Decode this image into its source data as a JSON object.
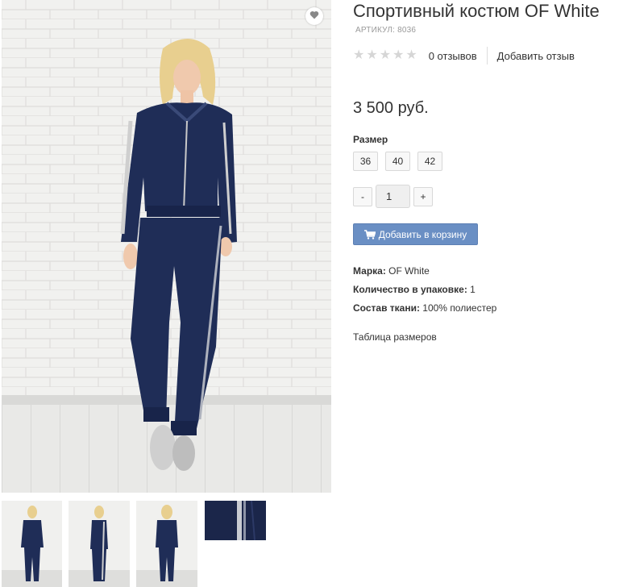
{
  "product": {
    "title": "Спортивный костюм OF White",
    "sku_label": "АРТИКУЛ:",
    "sku": "8036",
    "rating": {
      "stars_filled": 0,
      "stars_total": 5,
      "reviews": "0 отзывов",
      "add_review": "Добавить отзыв"
    },
    "price": "3 500 руб.",
    "size_label": "Размер",
    "sizes": [
      "36",
      "40",
      "42"
    ],
    "quantity": {
      "minus": "-",
      "value": "1",
      "plus": "+"
    },
    "add_to_cart": "Добавить в корзину",
    "specs": [
      {
        "label": "Марка:",
        "value": " OF White"
      },
      {
        "label": "Количество в упаковке:",
        "value": " 1"
      },
      {
        "label": "Состав ткани:",
        "value": " 100% полиестер"
      }
    ],
    "size_table_link": "Таблица размеров"
  },
  "icons": {
    "wishlist": "heart-icon",
    "cart": "cart-icon",
    "star": "star-icon"
  },
  "colors": {
    "accent": "#6a8fc4",
    "suit": "#1f2d57",
    "stars": "#d6d6d6"
  }
}
